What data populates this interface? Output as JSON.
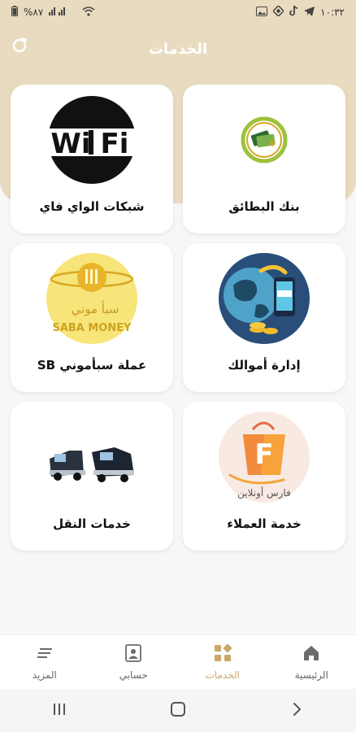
{
  "status_bar": {
    "time": "١٠:٣٢",
    "battery": "%٨٧"
  },
  "header": {
    "title": "الخدمات"
  },
  "services": [
    {
      "label": "شبكات الواي فاي",
      "icon": "wifi-logo-icon"
    },
    {
      "label": "بنك البطائق",
      "icon": "card-bank-icon"
    },
    {
      "label": "عملة سبأموني SB",
      "icon": "saba-money-coin-icon"
    },
    {
      "label": "إدارة أموالك",
      "icon": "money-management-icon"
    },
    {
      "label": "خدمات النقل",
      "icon": "trucks-icon"
    },
    {
      "label": "خدمة العملاء",
      "icon": "shopping-bag-icon"
    }
  ],
  "logo_text": {
    "wifi_left": "Wi",
    "wifi_right": "Fi",
    "saba_arabic": "سبأ موني",
    "saba_latin": "SABA MONEY",
    "customer_service_arabic": "فارس أونلاين"
  },
  "bottom_nav": [
    {
      "label": "الرئيسية",
      "icon": "home-icon",
      "active": false
    },
    {
      "label": "الخدمات",
      "icon": "services-grid-icon",
      "active": true
    },
    {
      "label": "حسابي",
      "icon": "account-icon",
      "active": false
    },
    {
      "label": "المزيد",
      "icon": "more-menu-icon",
      "active": false
    }
  ],
  "colors": {
    "header_bg": "#e9dbc0",
    "accent": "#c9a86a",
    "page_bg": "#f7f7f7"
  }
}
